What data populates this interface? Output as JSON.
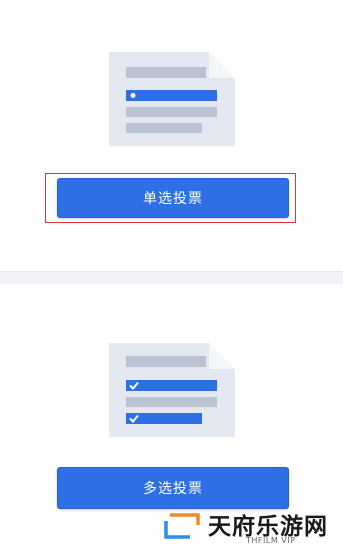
{
  "single_vote": {
    "label": "单选投票"
  },
  "multi_vote": {
    "label": "多选投票"
  },
  "watermark": {
    "title": "天府乐游网",
    "subtitle": "THFILM VIP"
  },
  "colors": {
    "accent": "#2f6fe6",
    "highlight": "#d9363e",
    "doc_bg": "#e4e8f0",
    "doc_line": "#b9c3d1"
  },
  "icons": {
    "single": "document-single-choice-icon",
    "multi": "document-multi-choice-icon",
    "check": "checkmark-icon",
    "logo": "site-logo-icon"
  }
}
